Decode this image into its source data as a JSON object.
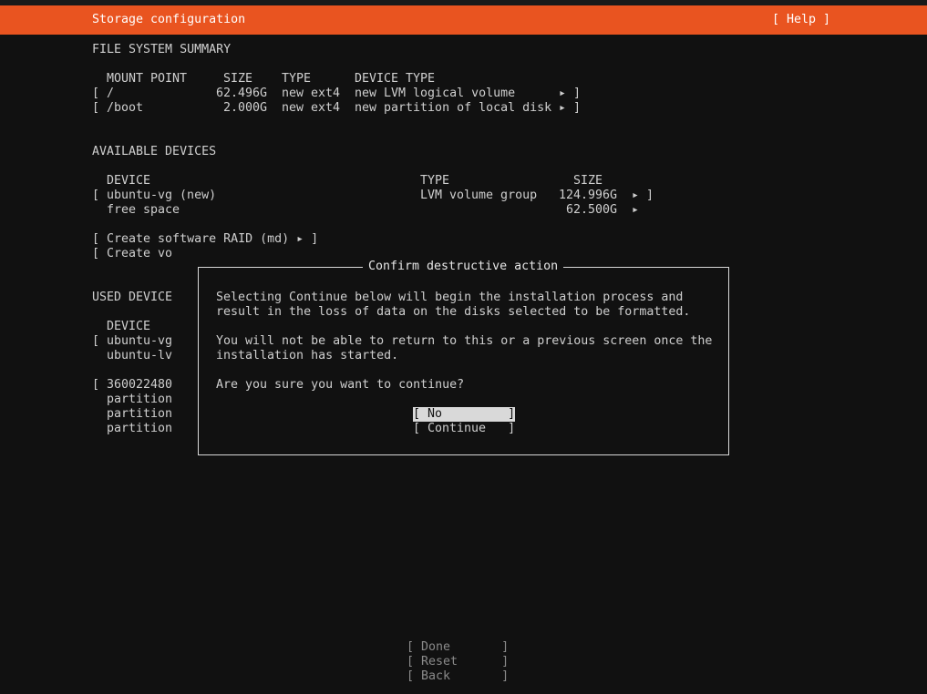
{
  "header": {
    "title": "Storage configuration",
    "help": "[ Help ]"
  },
  "fs_summary": {
    "heading": "FILE SYSTEM SUMMARY",
    "col_mount": "MOUNT POINT",
    "col_size": "SIZE",
    "col_type": "TYPE",
    "col_device_type": "DEVICE TYPE",
    "rows": [
      {
        "open": "[",
        "mount": "/",
        "size": "62.496G",
        "type": "new ext4",
        "device_type": "new LVM logical volume",
        "arrow": "▸ ]"
      },
      {
        "open": "[",
        "mount": "/boot",
        "size": "2.000G",
        "type": "new ext4",
        "device_type": "new partition of local disk",
        "arrow": "▸ ]"
      }
    ]
  },
  "available": {
    "heading": "AVAILABLE DEVICES",
    "col_device": "DEVICE",
    "col_type": "TYPE",
    "col_size": "SIZE",
    "vg": {
      "open": "[",
      "name": "ubuntu-vg (new)",
      "type": "LVM volume group",
      "size": "124.996G",
      "arrow": "▸ ]"
    },
    "free": {
      "name": "free space",
      "size": "62.500G",
      "arrow": "▸"
    },
    "create_raid": "[ Create software RAID (md) ▸ ]",
    "create_vg": "[ Create vo"
  },
  "used": {
    "heading": "USED DEVICE",
    "col_device": "DEVICE",
    "rows": [
      {
        "open": "[",
        "name": "ubuntu-vg"
      },
      {
        "open": "",
        "name": "ubuntu-lv"
      },
      {
        "open": "[",
        "name": "360022480"
      },
      {
        "open": "",
        "name": "partition"
      },
      {
        "open": "",
        "name": "partition"
      },
      {
        "open": "",
        "name": "partition"
      }
    ]
  },
  "dialog": {
    "title": "Confirm destructive action",
    "line1": "Selecting Continue below will begin the installation process and",
    "line2": "result in the loss of data on the disks selected to be formatted.",
    "line3": "You will not be able to return to this or a previous screen once the",
    "line4": "installation has started.",
    "question": "Are you sure you want to continue?",
    "no_button": "[ No         ]",
    "continue_button": "[ Continue   ]"
  },
  "footer": {
    "done": "[ Done       ]",
    "reset": "[ Reset      ]",
    "back": "[ Back       ]"
  },
  "colors": {
    "title_bar": "#e95420",
    "background": "#111111",
    "text": "#cfcfcf"
  }
}
